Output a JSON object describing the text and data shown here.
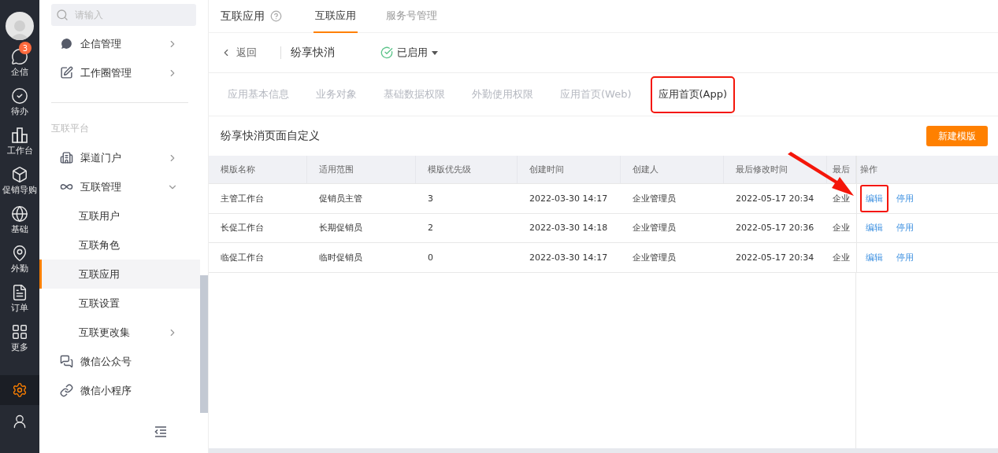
{
  "rail": {
    "items": [
      {
        "label": "企信",
        "badge": "3",
        "selected": false
      },
      {
        "label": "待办",
        "selected": false
      },
      {
        "label": "工作台",
        "selected": false
      },
      {
        "label": "促销导购",
        "selected": false
      },
      {
        "label": "基础",
        "selected": false
      },
      {
        "label": "外勤",
        "selected": false
      },
      {
        "label": "订单",
        "selected": false
      },
      {
        "label": "更多",
        "selected": false
      }
    ],
    "tools": [
      {
        "kind": "settings",
        "selected": true
      },
      {
        "kind": "contacts",
        "selected": false
      }
    ]
  },
  "sidebar": {
    "search": {
      "placeholder": "请输入"
    },
    "groups": [
      {
        "items": [
          {
            "label": "企信管理",
            "has_arrow": true,
            "selected": false
          },
          {
            "label": "工作圈管理",
            "has_arrow": true,
            "selected": false
          }
        ]
      },
      {
        "title": "互联平台",
        "items": [
          {
            "label": "渠道门户",
            "has_arrow": true,
            "selected": false
          },
          {
            "label": "互联管理",
            "expanded": true,
            "selected": false,
            "children": [
              {
                "label": "互联用户",
                "selected": false
              },
              {
                "label": "互联角色",
                "selected": false
              },
              {
                "label": "互联应用",
                "selected": true
              },
              {
                "label": "互联设置",
                "selected": false
              },
              {
                "label": "互联更改集",
                "has_arrow": true,
                "selected": false
              }
            ]
          },
          {
            "label": "微信公众号",
            "selected": false
          },
          {
            "label": "微信小程序",
            "selected": false
          }
        ]
      }
    ]
  },
  "header": {
    "title": "互联应用",
    "tabs": [
      {
        "label": "互联应用",
        "selected": true
      },
      {
        "label": "服务号管理",
        "selected": false
      }
    ]
  },
  "app_bar": {
    "back": "返回",
    "name": "纷享快消",
    "status": "已启用"
  },
  "sub_tabs": [
    {
      "label": "应用基本信息",
      "selected": false,
      "highlighted": false
    },
    {
      "label": "业务对象",
      "selected": false,
      "highlighted": false
    },
    {
      "label": "基础数据权限",
      "selected": false,
      "highlighted": false
    },
    {
      "label": "外勤使用权限",
      "selected": false,
      "highlighted": false
    },
    {
      "label": "应用首页(Web)",
      "selected": false,
      "highlighted": false
    },
    {
      "label": "应用首页(App)",
      "selected": true,
      "highlighted": true
    }
  ],
  "section": {
    "title": "纷享快消页面自定义",
    "button": "新建模版"
  },
  "table": {
    "columns": [
      "模版名称",
      "适用范围",
      "模版优先级",
      "创建时间",
      "创建人",
      "最后修改时间",
      "最后"
    ],
    "actions_column": "操作",
    "rows": [
      {
        "cells": [
          "主管工作台",
          "促销员主管",
          "3",
          "2022-03-30 14:17",
          "企业管理员",
          "2022-05-17 20:34",
          "企业"
        ],
        "actions": [
          {
            "label": "编辑",
            "highlighted": true
          },
          {
            "label": "停用",
            "highlighted": false
          }
        ]
      },
      {
        "cells": [
          "长促工作台",
          "长期促销员",
          "2",
          "2022-03-30 14:18",
          "企业管理员",
          "2022-05-17 20:36",
          "企业"
        ],
        "actions": [
          {
            "label": "编辑",
            "highlighted": false
          },
          {
            "label": "停用",
            "highlighted": false
          }
        ]
      },
      {
        "cells": [
          "临促工作台",
          "临时促销员",
          "0",
          "2022-03-30 14:17",
          "企业管理员",
          "2022-05-17 20:34",
          "企业"
        ],
        "actions": [
          {
            "label": "编辑",
            "highlighted": false
          },
          {
            "label": "停用",
            "highlighted": false
          }
        ]
      }
    ]
  }
}
